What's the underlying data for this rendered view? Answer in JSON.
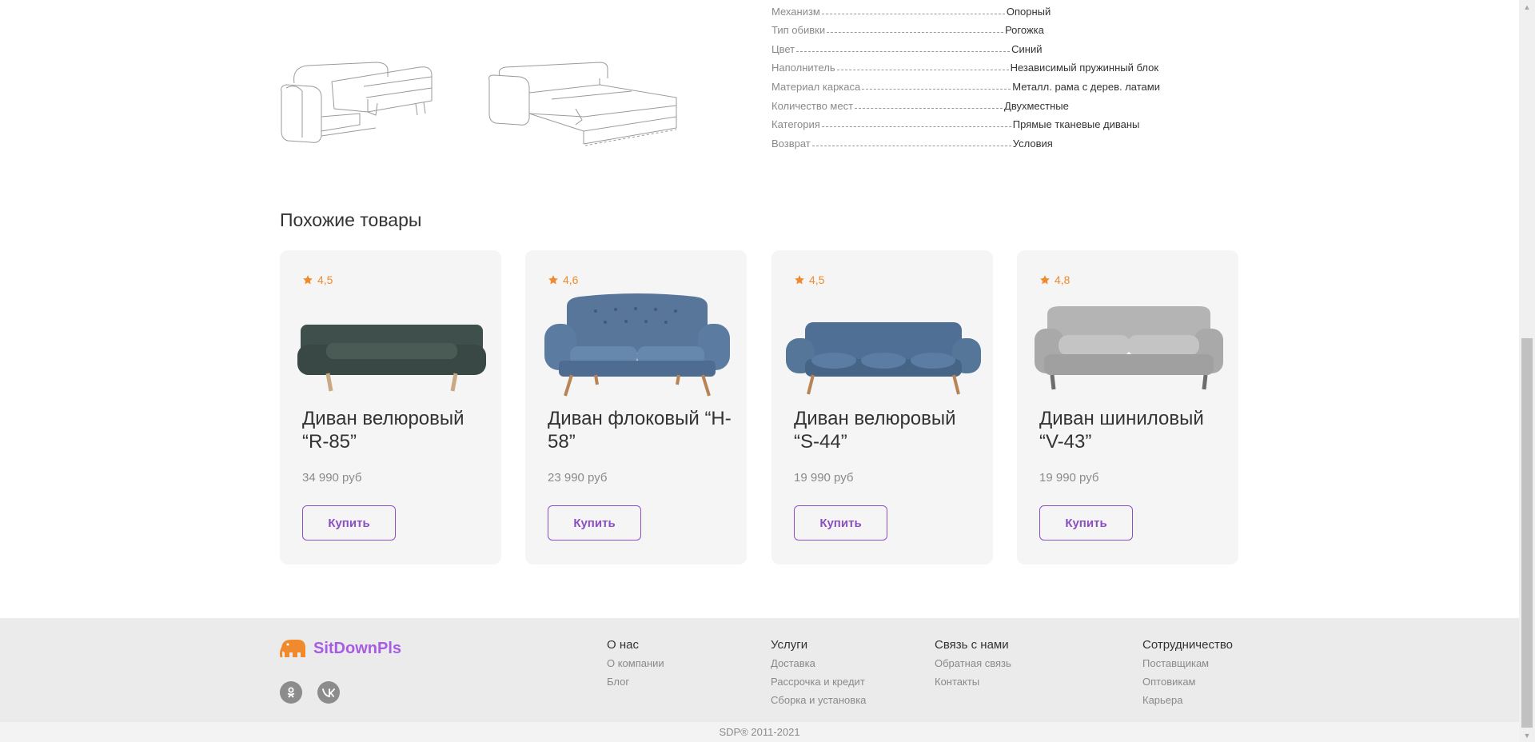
{
  "specs": [
    {
      "label": "Механизм",
      "value": "Опорный"
    },
    {
      "label": "Тип обивки",
      "value": "Рогожка"
    },
    {
      "label": "Цвет",
      "value": "Синий"
    },
    {
      "label": "Наполнитель",
      "value": "Независимый пружинный блок"
    },
    {
      "label": "Материал каркаса",
      "value": "Металл. рама с дерев. латами"
    },
    {
      "label": "Количество мест",
      "value": "Двухместные"
    },
    {
      "label": "Категория",
      "value": "Прямые тканевые диваны"
    },
    {
      "label": "Возврат",
      "value": "Условия"
    }
  ],
  "similar": {
    "title": "Похожие товары",
    "products": [
      {
        "rating": "4,5",
        "title": "Диван велюровый “R-85”",
        "price": "34 990 руб",
        "buy_label": "Купить",
        "color": "#3f4f4b"
      },
      {
        "rating": "4,6",
        "title": "Диван флоковый “H-58”",
        "price": "23 990 руб",
        "buy_label": "Купить",
        "color": "#57769a"
      },
      {
        "rating": "4,5",
        "title": "Диван велюровый “S-44”",
        "price": "19 990 руб",
        "buy_label": "Купить",
        "color": "#4f6f95"
      },
      {
        "rating": "4,8",
        "title": "Диван шиниловый “V-43”",
        "price": "19 990 руб",
        "buy_label": "Купить",
        "color": "#a9a9a9"
      }
    ]
  },
  "footer": {
    "brand": "SitDownPls",
    "columns": [
      {
        "heading": "О нас",
        "links": [
          "О компании",
          "Блог"
        ]
      },
      {
        "heading": "Услуги",
        "links": [
          "Доставка",
          "Рассрочка и кредит",
          "Сборка и установка"
        ]
      },
      {
        "heading": "Связь с нами",
        "links": [
          "Обратная связь",
          "Контакты"
        ]
      },
      {
        "heading": "Сотрудничество",
        "links": [
          "Поставщикам",
          "Оптовикам",
          "Карьера"
        ]
      }
    ],
    "social": [
      "odnoklassniki-icon",
      "vk-icon"
    ],
    "copyright": "SDP®   2011-2021"
  },
  "colors": {
    "accent": "#8a4fc2",
    "rating": "#f08a2c",
    "brand": "#a65de3",
    "logo": "#f08a2c"
  }
}
